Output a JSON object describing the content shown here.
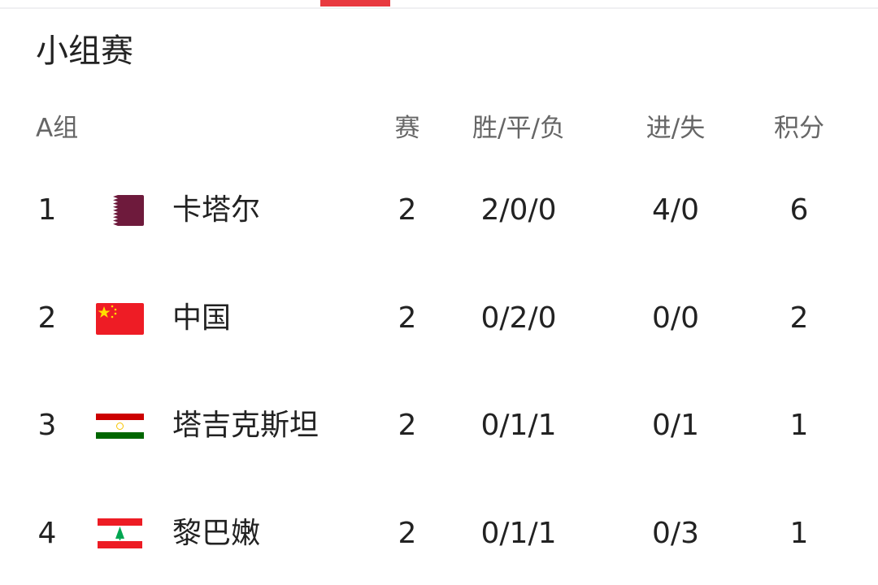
{
  "title": "小组赛",
  "header": {
    "group": "A组",
    "played": "赛",
    "wdl": "胜/平/负",
    "goals": "进/失",
    "points": "积分"
  },
  "colors": {
    "accent": "#e8393f"
  },
  "rows": [
    {
      "rank": "1",
      "team": "卡塔尔",
      "flag": "qatar-flag-icon",
      "played": "2",
      "wdl": "2/0/0",
      "goals": "4/0",
      "points": "6"
    },
    {
      "rank": "2",
      "team": "中国",
      "flag": "china-flag-icon",
      "played": "2",
      "wdl": "0/2/0",
      "goals": "0/0",
      "points": "2"
    },
    {
      "rank": "3",
      "team": "塔吉克斯坦",
      "flag": "tajikistan-flag-icon",
      "played": "2",
      "wdl": "0/1/1",
      "goals": "0/1",
      "points": "1"
    },
    {
      "rank": "4",
      "team": "黎巴嫩",
      "flag": "lebanon-flag-icon",
      "played": "2",
      "wdl": "0/1/1",
      "goals": "0/3",
      "points": "1"
    }
  ]
}
